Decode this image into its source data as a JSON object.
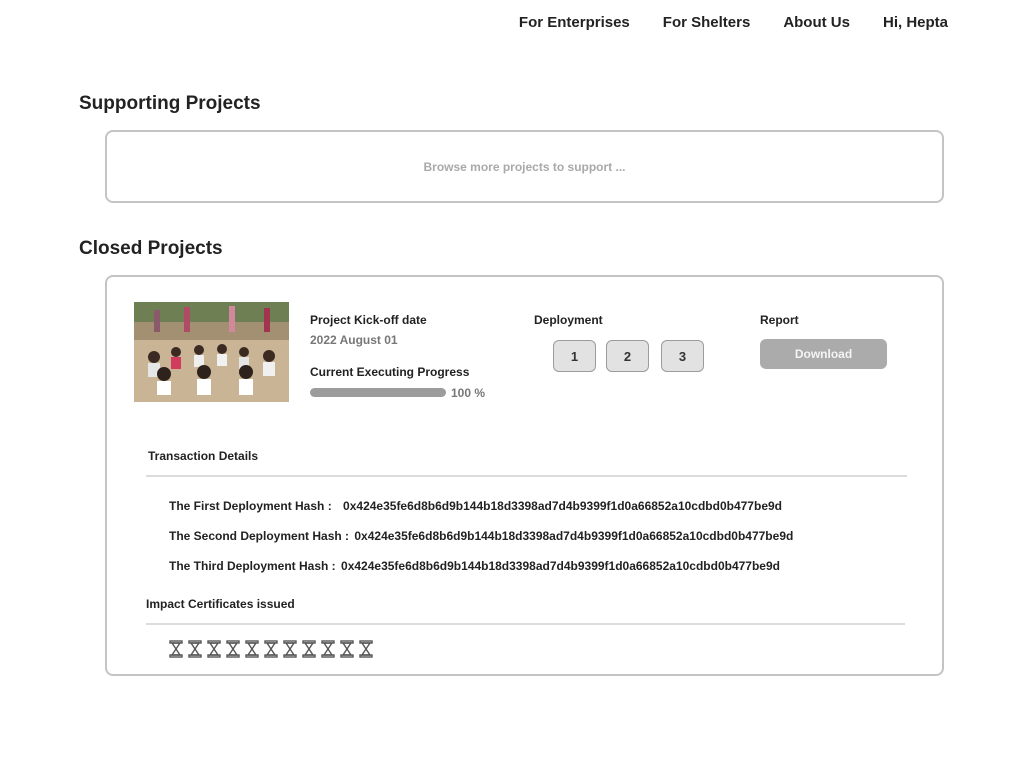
{
  "nav": {
    "items": [
      "For Enterprises",
      "For Shelters",
      "About Us"
    ],
    "greeting": "Hi, Hepta"
  },
  "supporting": {
    "title": "Supporting Projects",
    "browse_text": "Browse more projects to support ..."
  },
  "closed": {
    "title": "Closed Projects",
    "project": {
      "kickoff_label": "Project Kick-off date",
      "kickoff_date": "2022 August 01",
      "progress_label": "Current Executing Progress",
      "progress_value": 100,
      "progress_text": "100 %",
      "deployment_label": "Deployment",
      "deployment_buttons": [
        "1",
        "2",
        "3"
      ],
      "report_label": "Report",
      "download_label": "Download"
    },
    "transactions": {
      "title": "Transaction Details",
      "rows": [
        {
          "label": "The First Deployment Hash :",
          "hash": "0x424e35fe6d8b6d9b144b18d3398ad7d4b9399f1d0a66852a10cdbd0b477be9d"
        },
        {
          "label": "The Second Deployment Hash :",
          "hash": "0x424e35fe6d8b6d9b144b18d3398ad7d4b9399f1d0a66852a10cdbd0b477be9d"
        },
        {
          "label": "The Third Deployment Hash :",
          "hash": "0x424e35fe6d8b6d9b144b18d3398ad7d4b9399f1d0a66852a10cdbd0b477be9d"
        }
      ]
    },
    "certificates": {
      "title": "Impact Certificates issued",
      "count": 11,
      "icon": "hourglass-icon"
    }
  },
  "colors": {
    "card_border": "#c4c4c4",
    "button_bg": "#e2e2e2",
    "download_bg": "#ababab",
    "progress_bg": "#b4b4b4"
  }
}
